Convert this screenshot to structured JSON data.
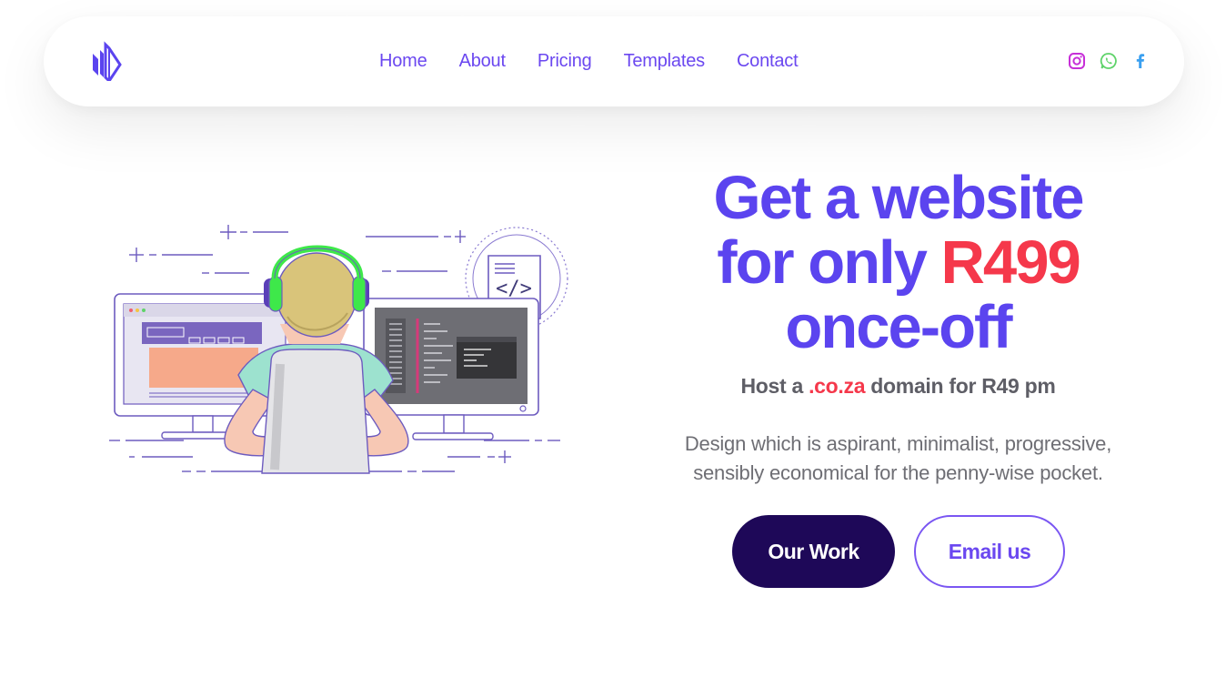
{
  "nav": {
    "logo_icon": "brand-logo",
    "links": [
      {
        "label": "Home"
      },
      {
        "label": "About"
      },
      {
        "label": "Pricing"
      },
      {
        "label": "Templates"
      },
      {
        "label": "Contact"
      }
    ],
    "social": [
      {
        "icon": "instagram-icon",
        "color": "#c72fd8"
      },
      {
        "icon": "whatsapp-icon",
        "color": "#5fd36a"
      },
      {
        "icon": "facebook-icon",
        "color": "#3ba0f0"
      }
    ]
  },
  "hero": {
    "title_line1": "Get a website",
    "title_line2_prefix": "for only ",
    "title_price": "R499",
    "title_line3": "once-off",
    "sub_prefix": "Host a ",
    "sub_domain": ".co.za",
    "sub_suffix": " domain for R49 pm",
    "desc_line1": "Design which is aspirant, minimalist, progressive,",
    "desc_line2": "sensibly economical for the penny-wise pocket.",
    "primary_button": "Our Work",
    "secondary_button": "Email us"
  },
  "illustration": {
    "code_symbol": "</>"
  },
  "colors": {
    "primary": "#5b44ef",
    "accent_red": "#f5384b",
    "dark_button": "#1e0858"
  }
}
